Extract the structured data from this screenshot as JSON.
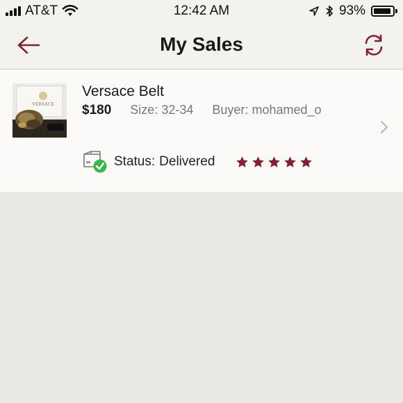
{
  "status_bar": {
    "carrier": "AT&T",
    "time": "12:42 AM",
    "battery_percent": "93%",
    "battery_level": 0.93,
    "icons": [
      "signal-icon",
      "wifi-icon",
      "location-arrow-icon",
      "bluetooth-icon",
      "battery-icon"
    ]
  },
  "nav": {
    "title": "My Sales",
    "back_icon": "back-arrow-icon",
    "refresh_icon": "refresh-icon"
  },
  "sale": {
    "title": "Versace Belt",
    "price": "$180",
    "size_label": "Size:",
    "size_value": "32-34",
    "buyer_label": "Buyer:",
    "buyer_value": "mohamed_o",
    "thumbnail_brand": "VERSACE",
    "status_label": "Status:",
    "status_value": "Delivered",
    "rating": 5,
    "rating_max": 5,
    "icons": [
      "delivered-box-icon",
      "chevron-right-icon",
      "star-icon"
    ]
  },
  "colors": {
    "accent": "#7e2332",
    "check_green": "#3cb54a",
    "background": "#eae8e3",
    "card": "#fbfaf9"
  }
}
